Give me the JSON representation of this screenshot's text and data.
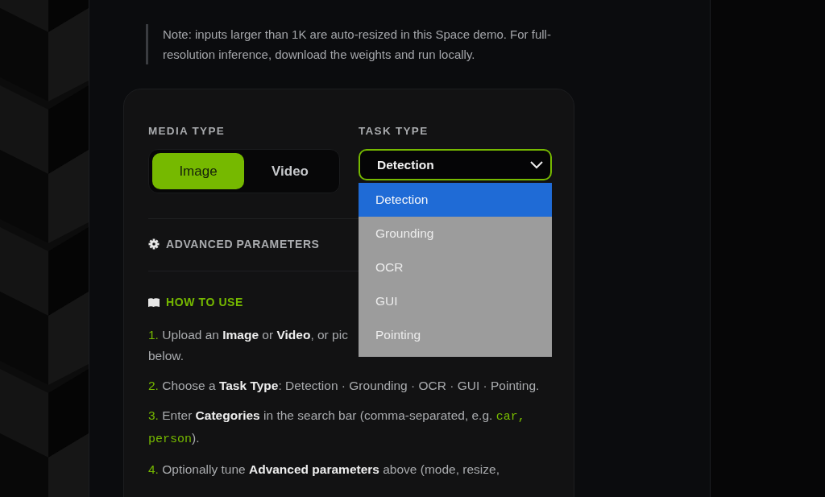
{
  "note": "Note: inputs larger than 1K are auto-resized in this Space demo. For full-resolution inference, download the weights and run locally.",
  "media_type": {
    "label": "MEDIA TYPE",
    "options": [
      {
        "label": "Image",
        "selected": true
      },
      {
        "label": "Video",
        "selected": false
      }
    ]
  },
  "task_type": {
    "label": "TASK TYPE",
    "value": "Detection",
    "expanded": true,
    "options": [
      {
        "label": "Detection",
        "selected": true
      },
      {
        "label": "Grounding",
        "selected": false
      },
      {
        "label": "OCR",
        "selected": false
      },
      {
        "label": "GUI",
        "selected": false
      },
      {
        "label": "Pointing",
        "selected": false
      }
    ]
  },
  "advanced": {
    "label": "ADVANCED PARAMETERS"
  },
  "how_to_use": {
    "title": "HOW TO USE",
    "steps": [
      {
        "number": "1.",
        "parts": [
          {
            "kind": "text",
            "text": "Upload an **Image** or **Video**, or pic"
          },
          {
            "kind": "break"
          },
          {
            "kind": "text",
            "text": "below."
          }
        ]
      },
      {
        "number": "2.",
        "parts": [
          {
            "kind": "text",
            "text": "Choose a **Task Type**: Detection · Grounding · OCR · GUI · Pointing."
          }
        ]
      },
      {
        "number": "3.",
        "parts": [
          {
            "kind": "text",
            "text": "Enter **Categories** in the search bar (comma-separated, e.g. "
          },
          {
            "kind": "code",
            "text": "car, person"
          },
          {
            "kind": "text",
            "text": ")."
          }
        ]
      },
      {
        "number": "4.",
        "parts": [
          {
            "kind": "text",
            "text": "Optionally tune **Advanced parameters** above (mode, resize,"
          }
        ]
      }
    ]
  }
}
